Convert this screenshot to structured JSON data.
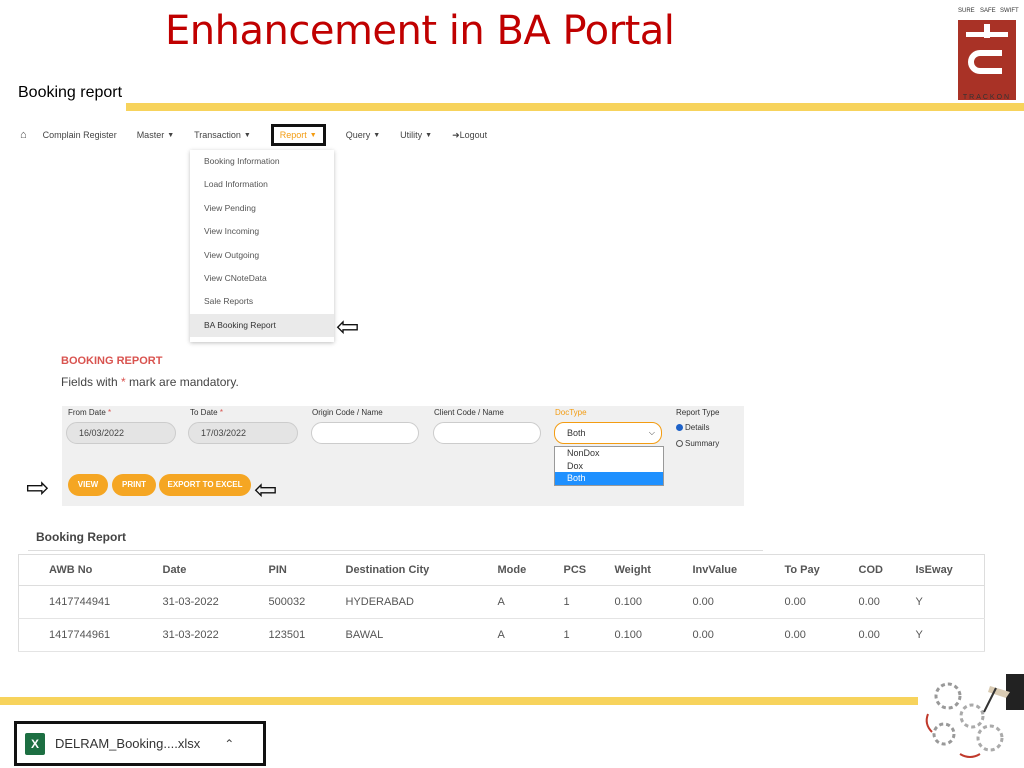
{
  "slide": {
    "title": "Enhancement in BA Portal",
    "subtitle": "Booking report"
  },
  "logo": {
    "top_labels": [
      "SURE",
      "SAFE",
      "SWIFT"
    ],
    "word": "TRACKON"
  },
  "nav": {
    "items": [
      "Complain Register",
      "Master",
      "Transaction",
      "Report",
      "Query",
      "Utility",
      "Logout"
    ]
  },
  "report_menu": {
    "items": [
      "Booking Information",
      "Load Information",
      "View Pending",
      "View Incoming",
      "View Outgoing",
      "View CNoteData",
      "Sale Reports",
      "BA Booking Report"
    ],
    "selected": "BA Booking Report"
  },
  "form": {
    "heading": "BOOKING REPORT",
    "mandatory_note_pre": "Fields with ",
    "mandatory_star": "*",
    "mandatory_note_post": " mark are mandatory.",
    "from_date_label": "From Date",
    "from_date_value": "16/03/2022",
    "to_date_label": "To Date",
    "to_date_value": "17/03/2022",
    "origin_label": "Origin Code / Name",
    "client_label": "Client Code / Name",
    "doctype_label": "DocType",
    "doctype_value": "Both",
    "doctype_options": [
      "NonDox",
      "Dox",
      "Both"
    ],
    "report_type_label": "Report Type",
    "report_type_options": [
      "Details",
      "Summary"
    ],
    "report_type_selected": "Details",
    "buttons": {
      "view": "VIEW",
      "print": "PRINT",
      "export": "EXPORT TO EXCEL"
    }
  },
  "table": {
    "heading": "Booking Report",
    "columns": [
      "AWB No",
      "Date",
      "PIN",
      "Destination City",
      "Mode",
      "PCS",
      "Weight",
      "InvValue",
      "To Pay",
      "COD",
      "IsEway"
    ],
    "rows": [
      [
        "1417744941",
        "31-03-2022",
        "500032",
        "HYDERABAD",
        "A",
        "1",
        "0.100",
        "0.00",
        "0.00",
        "0.00",
        "Y"
      ],
      [
        "1417744961",
        "31-03-2022",
        "123501",
        "BAWAL",
        "A",
        "1",
        "0.100",
        "0.00",
        "0.00",
        "0.00",
        "Y"
      ]
    ]
  },
  "download": {
    "filename": "DELRAM_Booking....xlsx",
    "icon": "excel-file-icon"
  },
  "colors": {
    "title": "#c00000",
    "accent": "#f5a623",
    "rule": "#f7d35c",
    "logo": "#a93226"
  }
}
